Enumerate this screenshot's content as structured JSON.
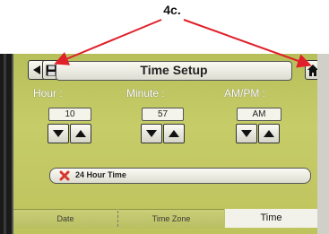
{
  "callout": {
    "label": "4c."
  },
  "header": {
    "title": "Time Setup",
    "back_icon": "back-arrow-icon",
    "save_icon": "floppy-disk-icon",
    "home_icon": "home-icon"
  },
  "fields": {
    "hour": {
      "label": "Hour :",
      "value": "10"
    },
    "minute": {
      "label": "Minute :",
      "value": "57"
    },
    "ampm": {
      "label": "AM/PM :",
      "value": "AM"
    }
  },
  "toggle": {
    "label": "24 Hour Time",
    "checked": false,
    "state_icon": "red-x-icon"
  },
  "tabs": [
    {
      "label": "Date",
      "active": false
    },
    {
      "label": "Time Zone",
      "active": false
    },
    {
      "label": "Time",
      "active": true
    }
  ],
  "colors": {
    "screen": "#c3c965",
    "callout_arrow": "#e0202a",
    "toggle_x": "#d9352f"
  }
}
